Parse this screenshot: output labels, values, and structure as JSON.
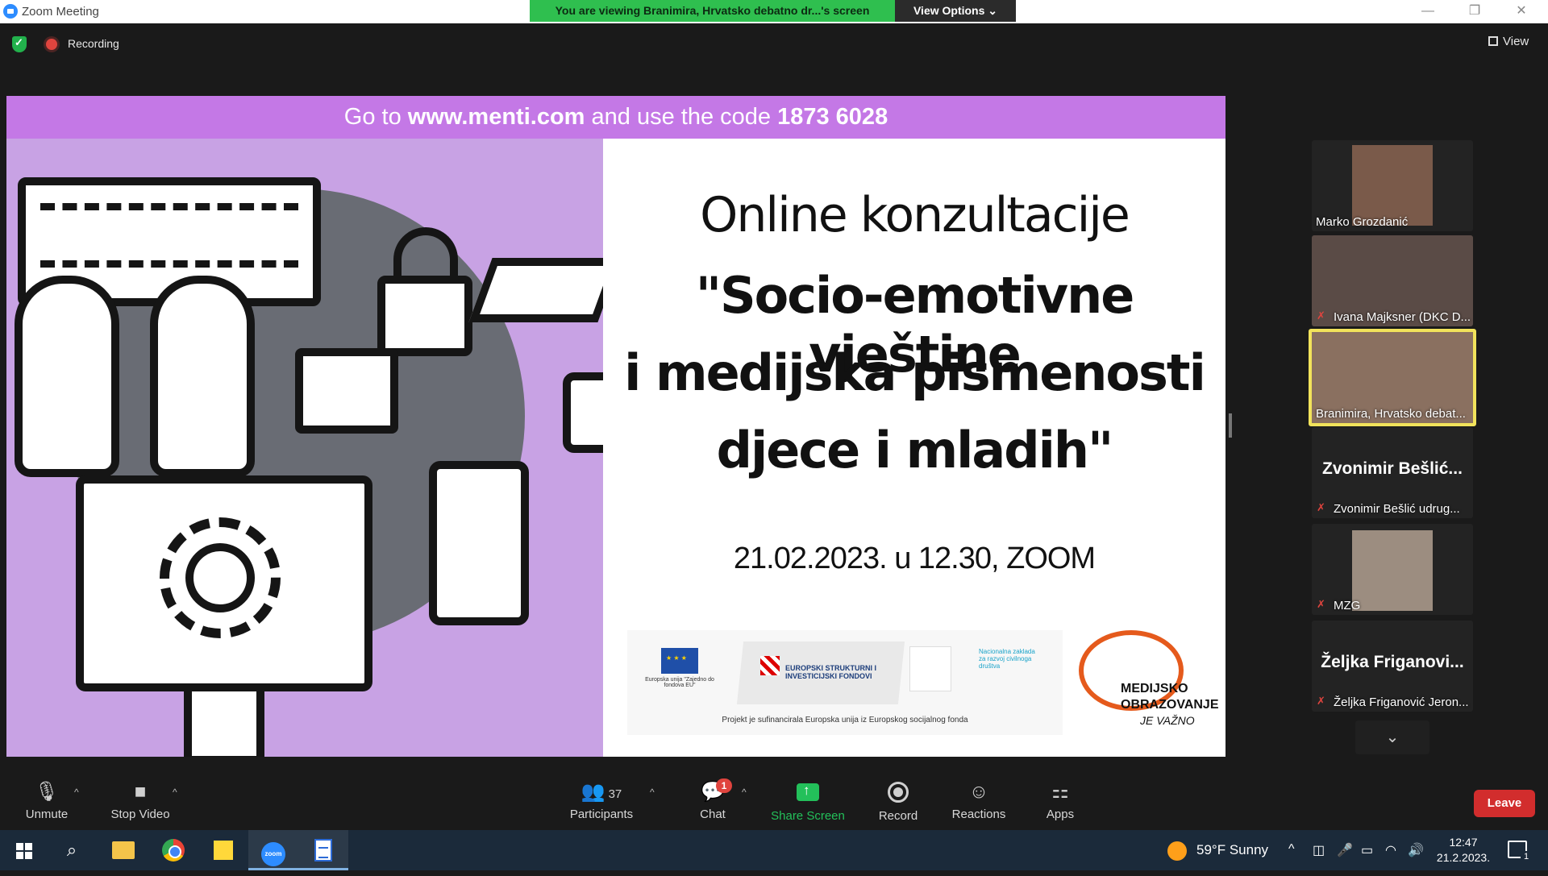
{
  "window": {
    "title": "Zoom Meeting",
    "viewing_banner": "You are viewing Branimira, Hrvatsko debatno dr...'s screen",
    "view_options_label": "View Options ⌄",
    "minimize": "—",
    "restore": "❐",
    "close": "✕"
  },
  "header": {
    "recording_label": "Recording",
    "view_label": "View"
  },
  "shared_screen": {
    "banner_prefix": "Go to ",
    "banner_url": "www.menti.com",
    "banner_middle": " and use the code ",
    "banner_code": "1873 6028",
    "title_line1": "Online konzultacije",
    "title_line2": "\"Socio-emotivne vještine",
    "title_line3": "i medijska pismenosti",
    "title_line4": "djece i mladih\"",
    "date": "21.02.2023. u 12.30, ZOOM",
    "logo_esif": "EUROPSKI STRUKTURNI I INVESTICIJSKI FONDOVI",
    "logo_eu_caption": "Europska unija \"Zajedno do fondova EU\"",
    "logo_nzrcd": "Nacionalna zaklada za razvoj civilnoga društva",
    "logo_caption": "Projekt je sufinancirala Europska unija iz Europskog socijalnog fonda",
    "logo_mo_line1": "MEDIJSKO",
    "logo_mo_line2": "OBRAZOVANJE",
    "logo_mo_line3": "JE VAŽNO"
  },
  "participants_gallery": [
    {
      "name": "Marko Grozdanić",
      "muted": false,
      "has_video": true
    },
    {
      "name": "Ivana Majksner (DKC D...",
      "muted": true,
      "has_video": true
    },
    {
      "name": "Branimira, Hrvatsko debat...",
      "muted": false,
      "has_video": true,
      "active_speaker": true
    },
    {
      "name": "Zvonimir Bešlić udrug...",
      "big_name": "Zvonimir  Bešlić...",
      "muted": true,
      "has_video": false
    },
    {
      "name": "MZG",
      "muted": true,
      "has_video": true
    },
    {
      "name": "Željka Friganović Jeron...",
      "big_name": "Željka  Friganovi...",
      "muted": true,
      "has_video": false
    }
  ],
  "toolbar": {
    "unmute": "Unmute",
    "stop_video": "Stop Video",
    "participants": "Participants",
    "participants_count": "37",
    "chat": "Chat",
    "chat_badge": "1",
    "share_screen": "Share Screen",
    "record": "Record",
    "reactions": "Reactions",
    "apps": "Apps",
    "leave": "Leave"
  },
  "taskbar": {
    "weather": "59°F  Sunny",
    "zoom_label": "zoom",
    "time": "12:47",
    "date": "21.2.2023.",
    "notification_count": "1"
  },
  "colors": {
    "viewing_banner": "#2fbf4f",
    "slide_band": "#c478e6",
    "slide_left_bg": "#c8a2e4",
    "active_speaker_border": "#f2e35b",
    "leave": "#d22d2d",
    "share_screen_icon": "#23c05a"
  }
}
